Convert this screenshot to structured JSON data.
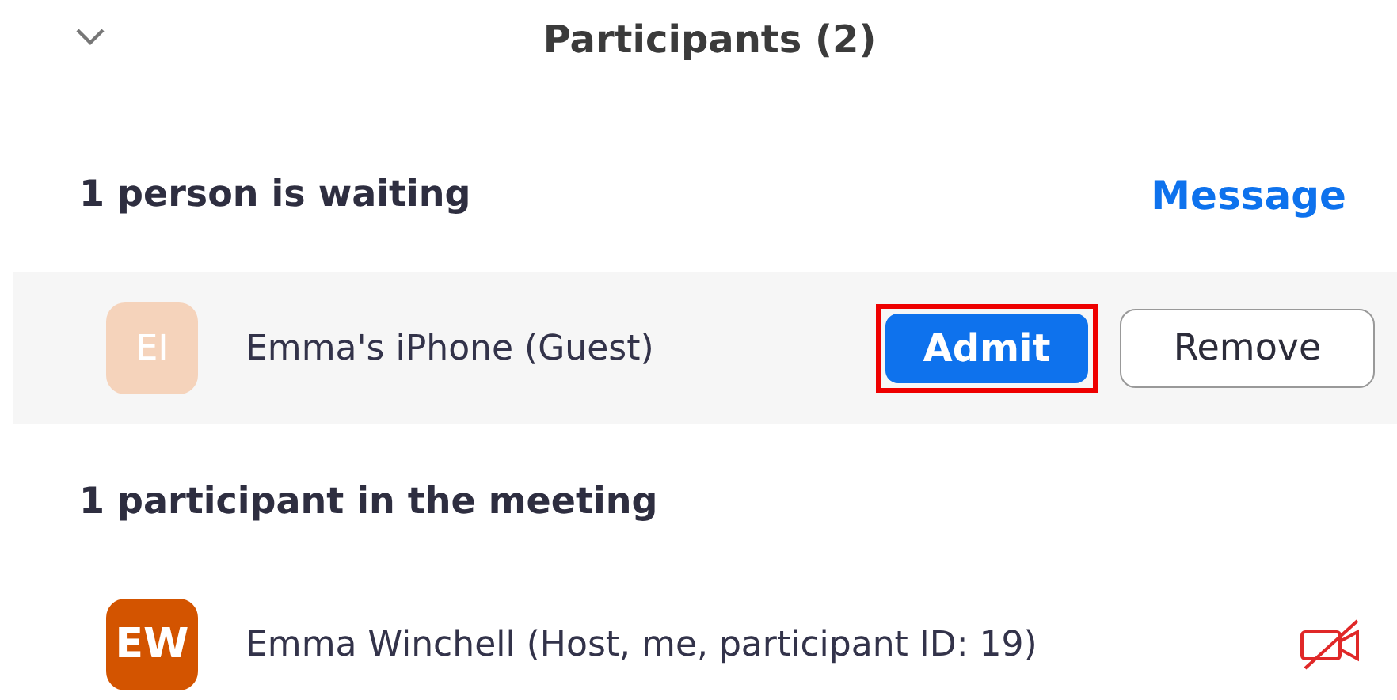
{
  "panel": {
    "title": "Participants (2)",
    "expanded": true
  },
  "waiting": {
    "heading": "1 person is waiting",
    "message_link": "Message",
    "people": [
      {
        "initials": "EI",
        "name": "Emma's iPhone (Guest)",
        "color": "#f5d3bb",
        "admit": "Admit",
        "remove": "Remove",
        "admit_highlighted": true
      }
    ]
  },
  "meeting": {
    "heading": "1 participant in the meeting",
    "people": [
      {
        "initials": "EW",
        "name": "Emma Winchell (Host, me, participant ID: 19)",
        "color": "#d35400",
        "video_off": true
      }
    ]
  }
}
